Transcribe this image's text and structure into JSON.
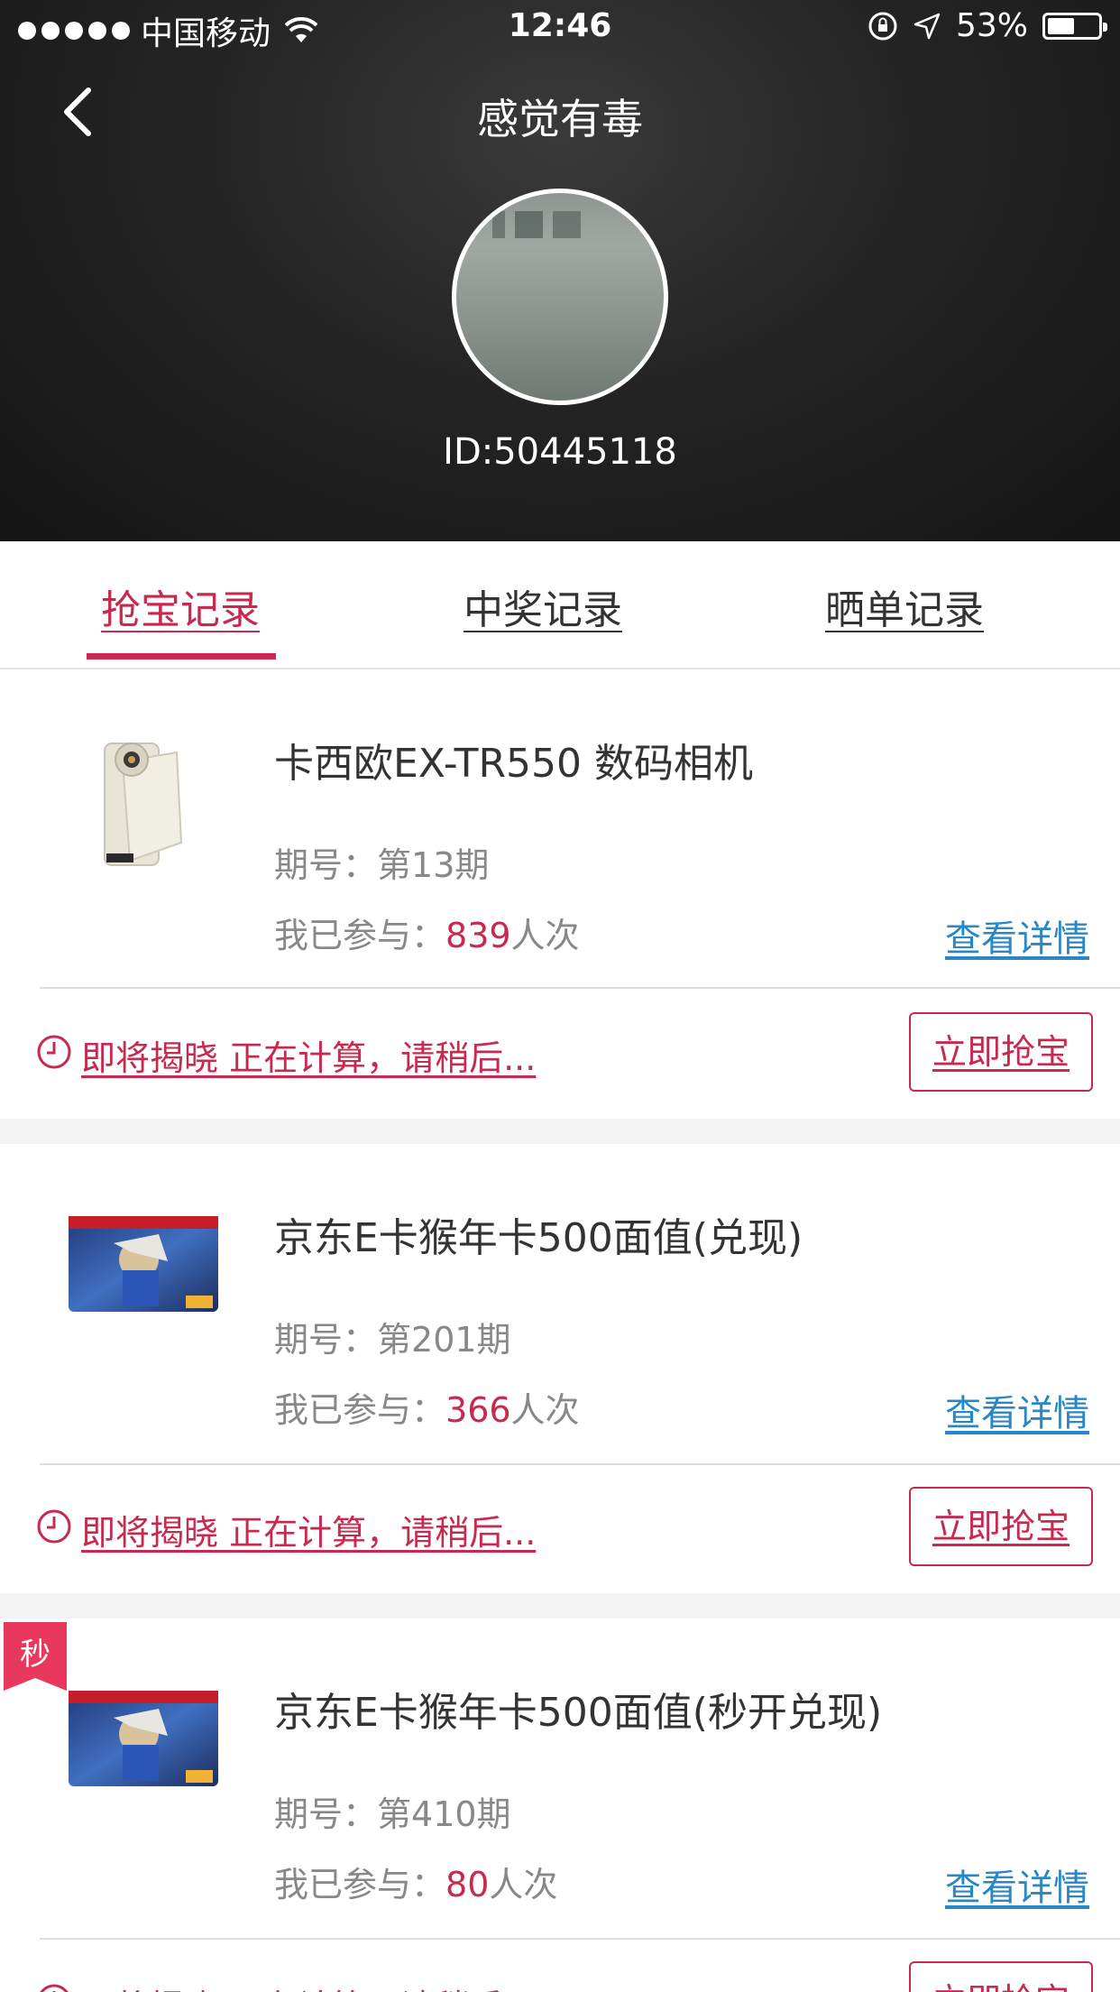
{
  "status_bar": {
    "carrier": "中国移动",
    "time": "12:46",
    "battery": "53%",
    "battery_level": 0.53
  },
  "header": {
    "title": "感觉有毒",
    "user_id": "ID:50445118"
  },
  "tabs": [
    {
      "label": "抢宝记录",
      "active": true
    },
    {
      "label": "中奖记录",
      "active": false
    },
    {
      "label": "晒单记录",
      "active": false
    }
  ],
  "colors": {
    "accent": "#c8294f",
    "link": "#2a87c6"
  },
  "records": [
    {
      "title": "卡西欧EX-TR550 数码相机",
      "period_label": "期号：",
      "period": "第13期",
      "joined_label": "我已参与：",
      "joined_count": "839",
      "joined_unit": "人次",
      "detail": "查看详情",
      "status": "即将揭晓 正在计算，请稍后...",
      "button": "立即抢宝",
      "image": "camera"
    },
    {
      "title": "京东E卡猴年卡500面值(兑现)",
      "period_label": "期号：",
      "period": "第201期",
      "joined_label": "我已参与：",
      "joined_count": "366",
      "joined_unit": "人次",
      "detail": "查看详情",
      "status": "即将揭晓 正在计算，请稍后...",
      "button": "立即抢宝",
      "image": "jd-card"
    },
    {
      "badge": "秒",
      "title": "京东E卡猴年卡500面值(秒开兑现)",
      "period_label": "期号：",
      "period": "第410期",
      "joined_label": "我已参与：",
      "joined_count": "80",
      "joined_unit": "人次",
      "detail": "查看详情",
      "status": "即将揭晓 正在计算，请稍后...",
      "button": "立即抢宝",
      "image": "jd-card"
    }
  ]
}
